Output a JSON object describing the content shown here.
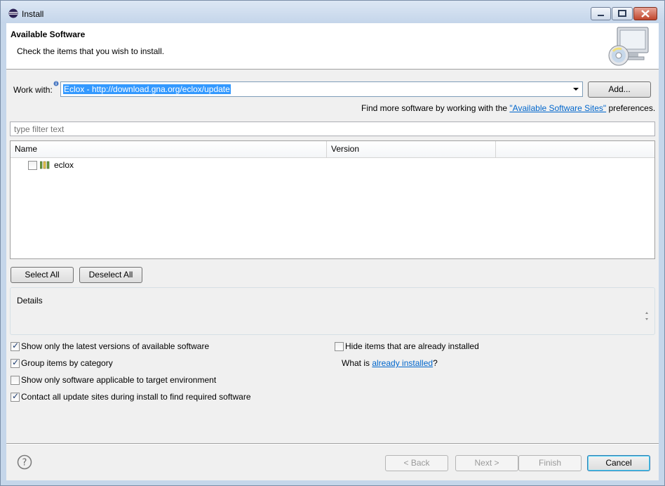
{
  "window": {
    "title": "Install"
  },
  "header": {
    "title": "Available Software",
    "description": "Check the items that you wish to install."
  },
  "work_with": {
    "label": "Work with:",
    "value": "Eclox - http://download.gna.org/eclox/update",
    "add_label": "Add..."
  },
  "more_software": {
    "prefix": "Find more software by working with the ",
    "link": "\"Available Software Sites\"",
    "suffix": " preferences."
  },
  "filter": {
    "placeholder": "type filter text"
  },
  "table": {
    "columns": [
      "Name",
      "Version"
    ],
    "rows": [
      {
        "name": "eclox",
        "version": "",
        "checked": false
      }
    ]
  },
  "selection_buttons": {
    "select_all": "Select All",
    "deselect_all": "Deselect All"
  },
  "details": {
    "label": "Details"
  },
  "options": {
    "latest_versions": {
      "label": "Show only the latest versions of available software",
      "checked": true
    },
    "group_by_category": {
      "label": "Group items by category",
      "checked": true
    },
    "target_env": {
      "label": "Show only software applicable to target environment",
      "checked": false
    },
    "contact_sites": {
      "label": "Contact all update sites during install to find required software",
      "checked": true
    },
    "hide_installed": {
      "label": "Hide items that are already installed",
      "checked": false
    },
    "what_is": {
      "prefix": "What is ",
      "link": "already installed",
      "suffix": "?"
    }
  },
  "footer": {
    "back": "< Back",
    "next": "Next >",
    "finish": "Finish",
    "cancel": "Cancel"
  },
  "colors": {
    "accent": "#3399ff",
    "link": "#0066cc",
    "dialog_bg": "#f0f0f0"
  },
  "icons": [
    "eclipse-icon",
    "minimize-icon",
    "maximize-icon",
    "close-icon",
    "install-cd-icon",
    "info-icon",
    "dropdown-arrow-icon",
    "feature-icon",
    "help-icon"
  ]
}
